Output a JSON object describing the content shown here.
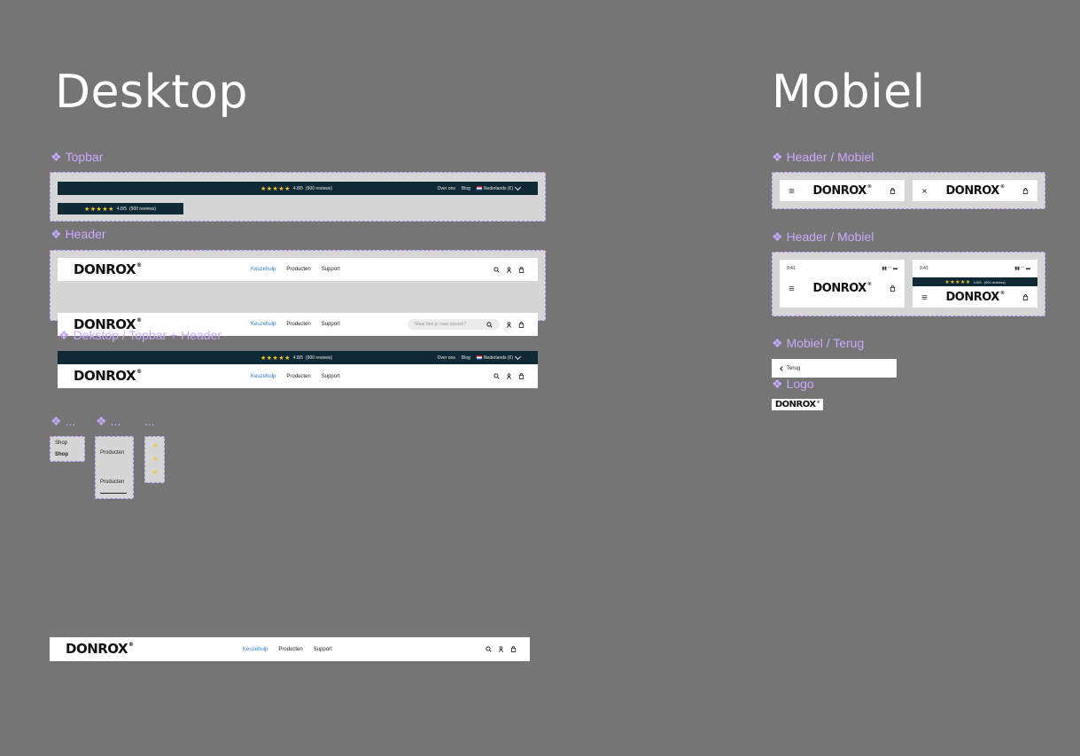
{
  "titles": {
    "desktop": "Desktop",
    "mobile": "Mobiel"
  },
  "labels": {
    "topbar": "Topbar",
    "header": "Header",
    "desktop_topbar_header": "Dekstop / Topbar + Header",
    "ellipsis_a": "...",
    "ellipsis_b": "...",
    "ellipsis_c": "...",
    "header_mobile_1": "Header / Mobiel",
    "header_mobile_2": "Header / Mobiel",
    "mobile_back": "Mobiel / Terug",
    "logo": "Logo"
  },
  "topbar": {
    "stars": "★★★★★",
    "rating": "4.8/5",
    "reviews": "(900 reviews)",
    "about": "Over ons",
    "blog": "Blog",
    "language": "Nederlands (€)"
  },
  "brand": {
    "logo": "DONROX",
    "reg": "®"
  },
  "nav": {
    "keuzehulp": "Keuzehulp",
    "producten": "Producten",
    "support": "Support"
  },
  "search": {
    "placeholder": "Waar ben je naar opzoek?"
  },
  "shop": {
    "item1": "Shop",
    "item2": "Shop"
  },
  "producten_variants": {
    "item1": "Producten",
    "item2": "Producten"
  },
  "mobile": {
    "time": "9:41",
    "back": "Terug"
  },
  "colors": {
    "topbar_bg": "#0f2a36",
    "accent": "#2b7bbf",
    "star": "#f3c623",
    "component_label": "#c9a8ff",
    "canvas": "#757575"
  },
  "icons": [
    "search-icon",
    "user-icon",
    "bag-icon",
    "hamburger-icon",
    "close-icon",
    "chevron-down-icon",
    "chevron-left-icon",
    "flag-nl-icon",
    "star-icon"
  ]
}
